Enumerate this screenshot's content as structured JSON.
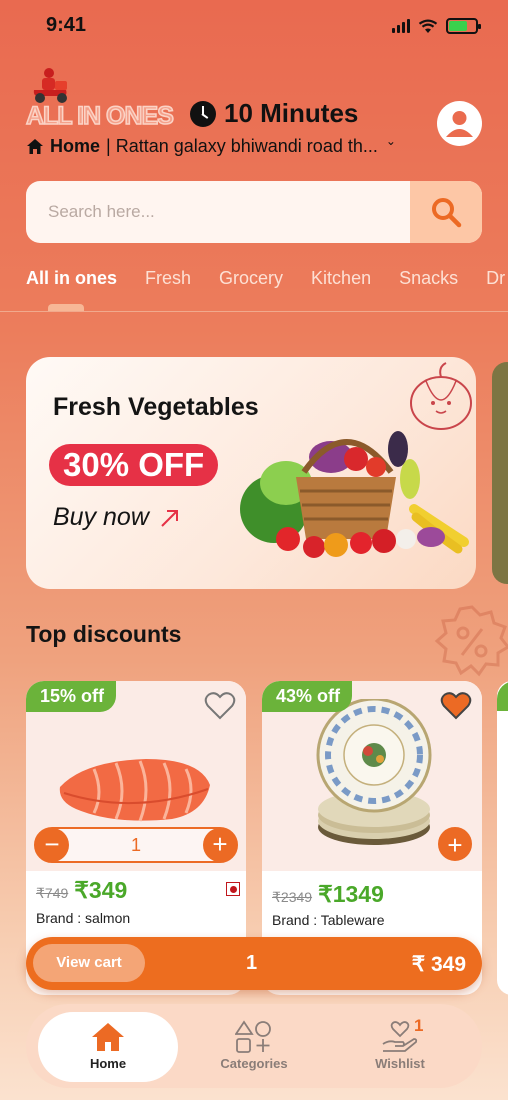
{
  "status_bar": {
    "time": "9:41"
  },
  "header": {
    "brand": "ALL IN ONES",
    "eta": "10 Minutes",
    "address_label": "Home",
    "address_text": "| Rattan galaxy bhiwandi road th..."
  },
  "search": {
    "placeholder": "Search here..."
  },
  "tabs": [
    "All in ones",
    "Fresh",
    "Grocery",
    "Kitchen",
    "Snacks",
    "Dr"
  ],
  "banner": {
    "title": "Fresh Vegetables",
    "discount": "30% OFF",
    "cta": "Buy now"
  },
  "section": {
    "title": "Top discounts"
  },
  "products": [
    {
      "off": "15% off",
      "mrp": "₹749",
      "price": "₹349",
      "brand": "Brand : salmon",
      "qty": "1",
      "wishlisted": false
    },
    {
      "off": "43% off",
      "mrp": "₹2349",
      "price": "₹1349",
      "brand": "Brand : Tableware",
      "wishlisted": true
    }
  ],
  "cart": {
    "button": "View cart",
    "count": "1",
    "total": "₹ 349"
  },
  "nav": {
    "home": "Home",
    "categories": "Categories",
    "wishlist": "Wishlist",
    "wishlist_count": "1"
  },
  "colors": {
    "accent": "#ec6a24",
    "discount_green": "#6bb33a",
    "offer_red": "#e63146"
  }
}
